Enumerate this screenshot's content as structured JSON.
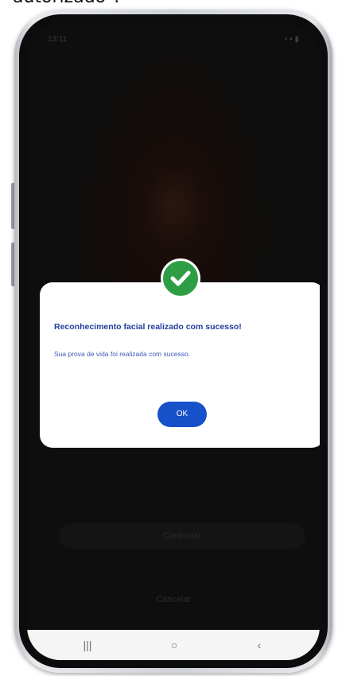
{
  "caption": {
    "text": "autorizado\"."
  },
  "screen": {
    "status_time": "13:11",
    "status_icons": "▪ ▪ ▮",
    "background_button_label": "Continuar",
    "background_link_label": "Cancelar"
  },
  "dialog": {
    "icon": "check-circle-icon",
    "title": "Reconhecimento facial realizado com sucesso!",
    "message": "Sua prova de vida foi realizada com sucesso.",
    "ok_label": "OK",
    "colors": {
      "title": "#1f3f9a",
      "button": "#1751c9",
      "success": "#2e9e45"
    }
  },
  "navigation": {
    "recents_glyph": "|||",
    "home_glyph": "○",
    "back_glyph": "‹",
    "icons": [
      "recents-icon",
      "home-icon",
      "back-icon"
    ]
  }
}
